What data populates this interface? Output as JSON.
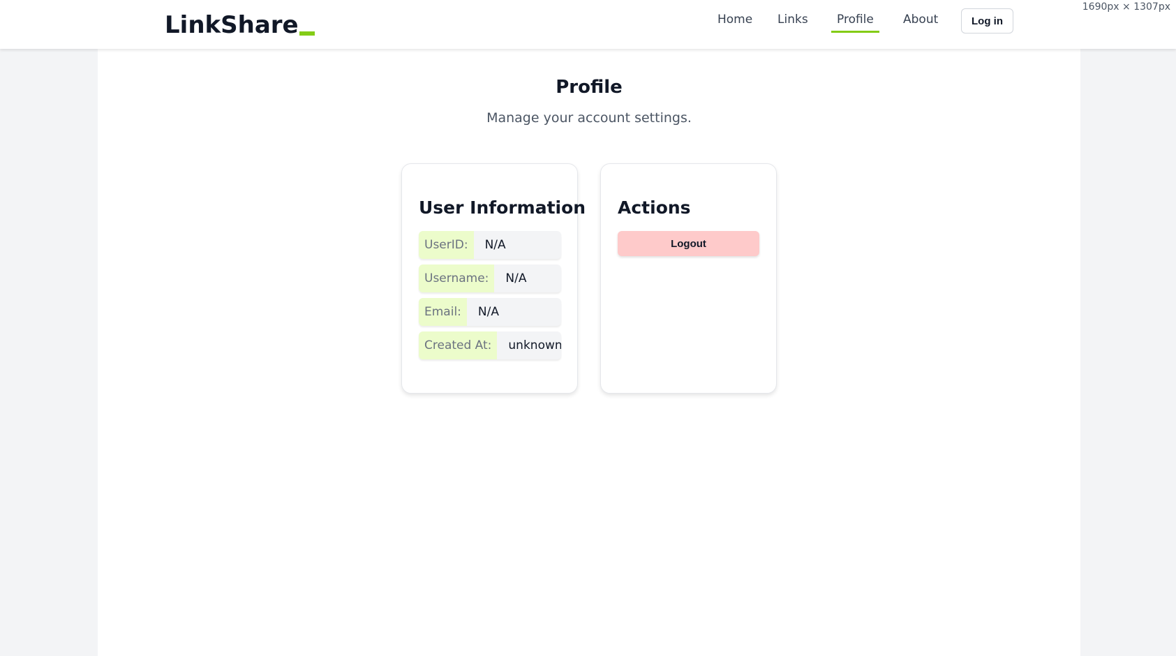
{
  "viewport_label": "1690px × 1307px",
  "header": {
    "brand": "LinkShare",
    "nav": [
      {
        "label": "Home",
        "active": false
      },
      {
        "label": "Links",
        "active": false
      },
      {
        "label": "Profile",
        "active": true
      },
      {
        "label": "About",
        "active": false
      }
    ],
    "login_label": "Log in"
  },
  "page": {
    "title": "Profile",
    "subtitle": "Manage your account settings."
  },
  "user_info": {
    "title": "User Information",
    "rows": [
      {
        "label": "UserID:",
        "value": "N/A"
      },
      {
        "label": "Username:",
        "value": "N/A"
      },
      {
        "label": "Email:",
        "value": "N/A"
      },
      {
        "label": "Created At:",
        "value": "unknown"
      }
    ]
  },
  "actions": {
    "title": "Actions",
    "logout_label": "Logout"
  },
  "colors": {
    "accent": "#84cc16",
    "label_bg": "#ecfccb",
    "logout_bg": "#fecaca",
    "page_bg": "#f3f4f6"
  }
}
